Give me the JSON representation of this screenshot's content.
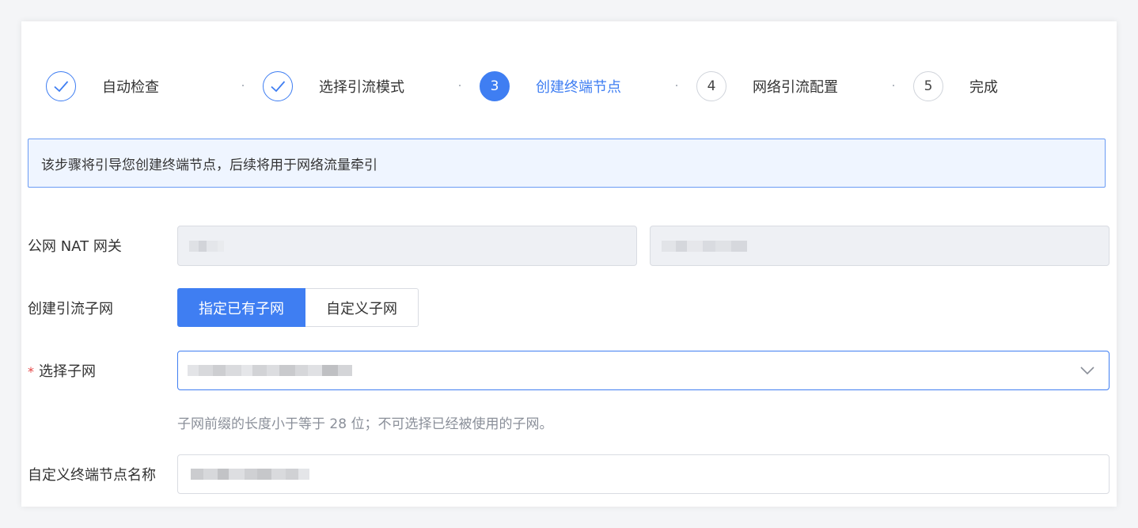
{
  "steps": [
    {
      "number": "",
      "label": "自动检查",
      "state": "done"
    },
    {
      "number": "",
      "label": "选择引流模式",
      "state": "done"
    },
    {
      "number": "3",
      "label": "创建终端节点",
      "state": "active"
    },
    {
      "number": "4",
      "label": "网络引流配置",
      "state": "pending"
    },
    {
      "number": "5",
      "label": "完成",
      "state": "pending"
    }
  ],
  "notice": "该步骤将引导您创建终端节点，后续将用于网络流量牵引",
  "form": {
    "nat_gateway_label": "公网 NAT 网关",
    "create_subnet_label": "创建引流子网",
    "subnet_mode_existing": "指定已有子网",
    "subnet_mode_custom": "自定义子网",
    "required_mark": "*",
    "select_subnet_label": "选择子网",
    "subnet_hint": "子网前缀的长度小于等于 28 位；不可选择已经被使用的子网。",
    "endpoint_name_label": "自定义终端节点名称"
  },
  "colors": {
    "accent": "#3f7ef2",
    "notice_bg": "#eff5ff",
    "required": "#e54545"
  }
}
